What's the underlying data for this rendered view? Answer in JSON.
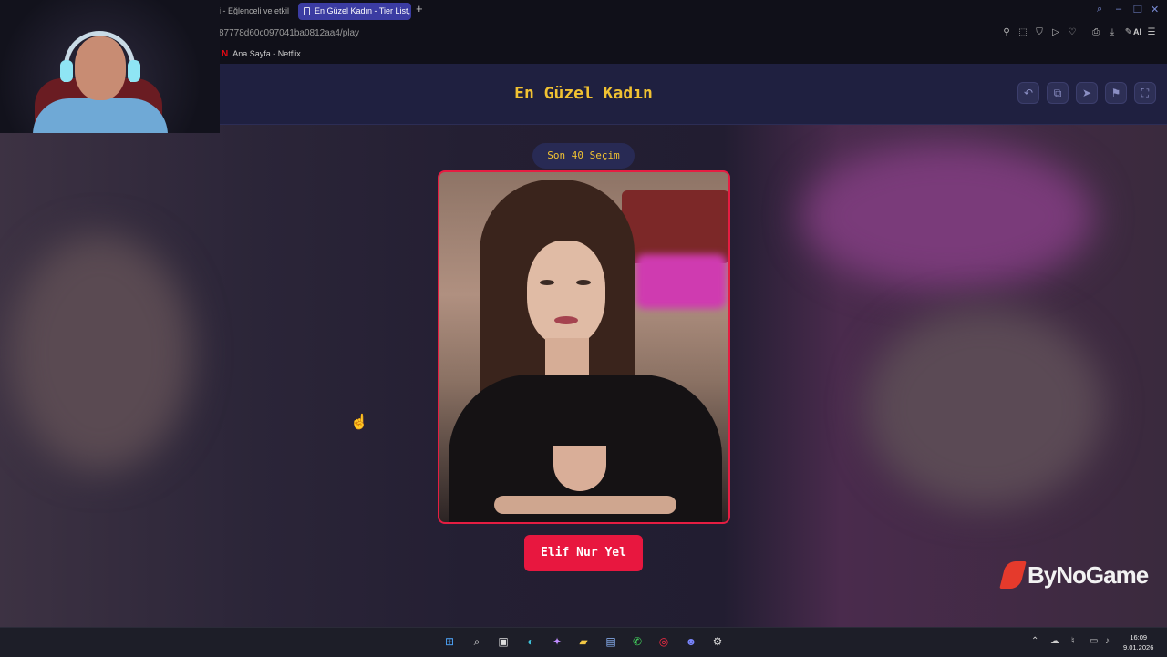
{
  "browser": {
    "tabs": [
      {
        "label": "i - Eğlenceli ve etkil",
        "active": false
      },
      {
        "label": "En Güzel Kadın - Tier List,",
        "active": true
      }
    ],
    "new_tab_symbol": "+",
    "url": "87778d60c097041ba0812aa4/play",
    "bookmark": {
      "icon": "N",
      "label": "Ana Sayfa - Netflix"
    },
    "toolbar_icons": [
      "bookmark-icon",
      "screenshot-icon",
      "shield-icon",
      "play-icon",
      "heart-icon",
      "print-icon",
      "download-icon",
      "ai-icon",
      "menu-icon"
    ],
    "ai_label": "AI"
  },
  "game": {
    "title": "En Güzel Kadın",
    "header_buttons": [
      "undo-icon",
      "share-icon",
      "send-icon",
      "flag-icon",
      "fullscreen-icon"
    ],
    "round_label": "Son 40 Seçim",
    "contestant_name": "Elif Nur Yel",
    "accent_color": "#e8173f",
    "title_color": "#f1c232"
  },
  "watermark": {
    "text": "ByNoGame"
  },
  "taskbar": {
    "apps": [
      "windows-start-icon",
      "search-icon",
      "task-view-icon",
      "edge-icon",
      "copilot-icon",
      "file-explorer-icon",
      "store-icon",
      "whatsapp-icon",
      "opera-gx-icon",
      "discord-icon",
      "steam-icon"
    ],
    "time": "16:09",
    "date": "9.01.2026"
  }
}
